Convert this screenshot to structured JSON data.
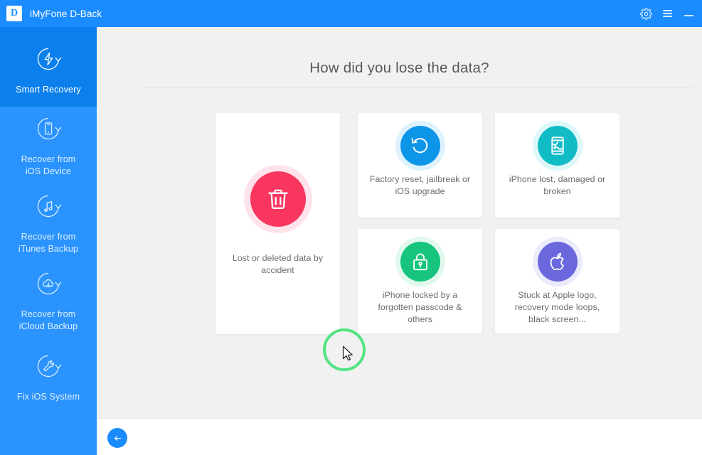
{
  "titlebar": {
    "logo_letter": "D",
    "app_title": "iMyFone D-Back",
    "settings_icon": "gear-icon",
    "menu_icon": "hamburger-menu-icon",
    "minimize_icon": "minimize-icon"
  },
  "sidebar": {
    "items": [
      {
        "label": "Smart Recovery",
        "icon": "bolt-refresh-icon",
        "active": true
      },
      {
        "label": "Recover from\niOS Device",
        "label_line1": "Recover from",
        "label_line2": "iOS Device",
        "icon": "phone-refresh-icon",
        "active": false
      },
      {
        "label": "Recover from\niTunes Backup",
        "label_line1": "Recover from",
        "label_line2": "iTunes Backup",
        "icon": "music-refresh-icon",
        "active": false
      },
      {
        "label": "Recover from\niCloud Backup",
        "label_line1": "Recover from",
        "label_line2": "iCloud Backup",
        "icon": "cloud-download-refresh-icon",
        "active": false
      },
      {
        "label": "Fix iOS System",
        "icon": "wrench-refresh-icon",
        "active": false
      }
    ]
  },
  "main": {
    "page_title": "How did you lose the data?",
    "cards": [
      {
        "id": "lost-or-deleted-data",
        "label": "Lost or deleted data by accident",
        "icon": "trash-icon",
        "color": "#f9365f"
      },
      {
        "id": "factory-reset",
        "label": "Factory reset, jailbreak or iOS upgrade",
        "icon": "reset-circular-arrow-icon",
        "color": "#0d95e8"
      },
      {
        "id": "iphone-lost-damaged",
        "label": "iPhone lost, damaged or broken",
        "icon": "cracked-phone-icon",
        "color": "#12bcc6"
      },
      {
        "id": "iphone-locked",
        "label": "iPhone locked by a forgotten passcode & others",
        "icon": "lock-icon",
        "color": "#17c47e"
      },
      {
        "id": "stuck-apple-logo",
        "label": "Stuck at Apple logo, recovery mode loops, black screen...",
        "icon": "apple-logo-icon",
        "color": "#6b68de"
      }
    ]
  },
  "bottombar": {
    "back_label": "Back",
    "back_icon": "arrow-left-icon"
  },
  "colors": {
    "brand_blue": "#1a8cfd",
    "sidebar_blue": "#2b93fe",
    "sidebar_active": "#0b80ec",
    "content_bg": "#f1f1f1",
    "cursor_highlight": "#53e383"
  }
}
